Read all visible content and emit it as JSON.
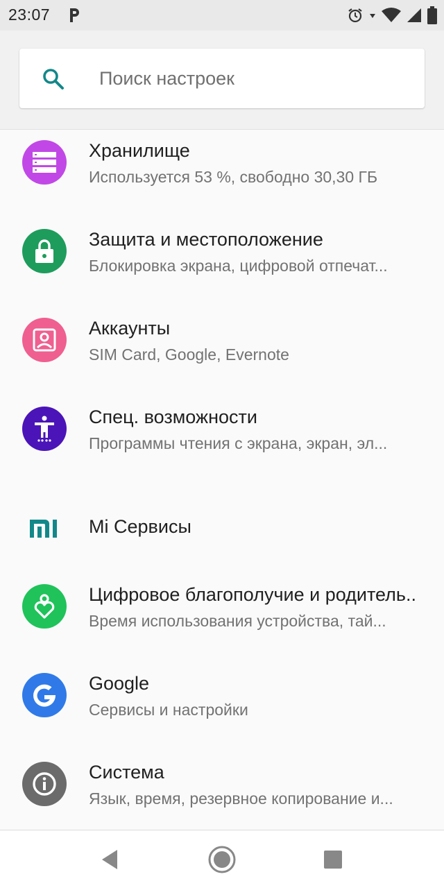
{
  "status_bar": {
    "time": "23:07",
    "app_notification_icon": "parking-p-icon",
    "icons": [
      "alarm-icon",
      "data-arrow-icon",
      "wifi-icon",
      "signal-icon",
      "battery-icon"
    ]
  },
  "search": {
    "placeholder": "Поиск настроек",
    "icon": "search-icon"
  },
  "settings_items": [
    {
      "title": "Хранилище",
      "subtitle": "Используется 53 %, свободно 30,30 ГБ",
      "icon": "storage-icon",
      "icon_bg": "#c148e6"
    },
    {
      "title": "Защита и местоположение",
      "subtitle": "Блокировка экрана, цифровой отпечат...",
      "icon": "lock-icon",
      "icon_bg": "#1e9c5c"
    },
    {
      "title": "Аккаунты",
      "subtitle": "SIM Card, Google, Evernote",
      "icon": "account-icon",
      "icon_bg": "#ef5f8f"
    },
    {
      "title": "Спец. возможности",
      "subtitle": "Программы чтения с экрана, экран, эл...",
      "icon": "accessibility-icon",
      "icon_bg": "#4b14b8"
    },
    {
      "title": "Mi Сервисы",
      "subtitle": "",
      "icon": "mi-logo-icon",
      "icon_color": "#12888a"
    },
    {
      "title": "Цифровое благополучие и родитель..",
      "subtitle": "Время использования устройства, тай...",
      "icon": "digital-wellbeing-icon",
      "icon_bg": "#1fc35a"
    },
    {
      "title": "Google",
      "subtitle": "Сервисы и настройки",
      "icon": "google-g-icon",
      "icon_bg": "#2f7ae8"
    },
    {
      "title": "Система",
      "subtitle": "Язык, время, резервное копирование и...",
      "icon": "info-icon",
      "icon_bg": "#6b6b6b"
    }
  ],
  "nav_bar": {
    "buttons": [
      "back-icon",
      "home-icon",
      "recents-icon"
    ]
  },
  "colors": {
    "header_bg": "#f1f1f1",
    "list_bg": "#fafafa",
    "search_icon": "#12888a",
    "title_text": "#202020",
    "subtitle_text": "#727272"
  }
}
